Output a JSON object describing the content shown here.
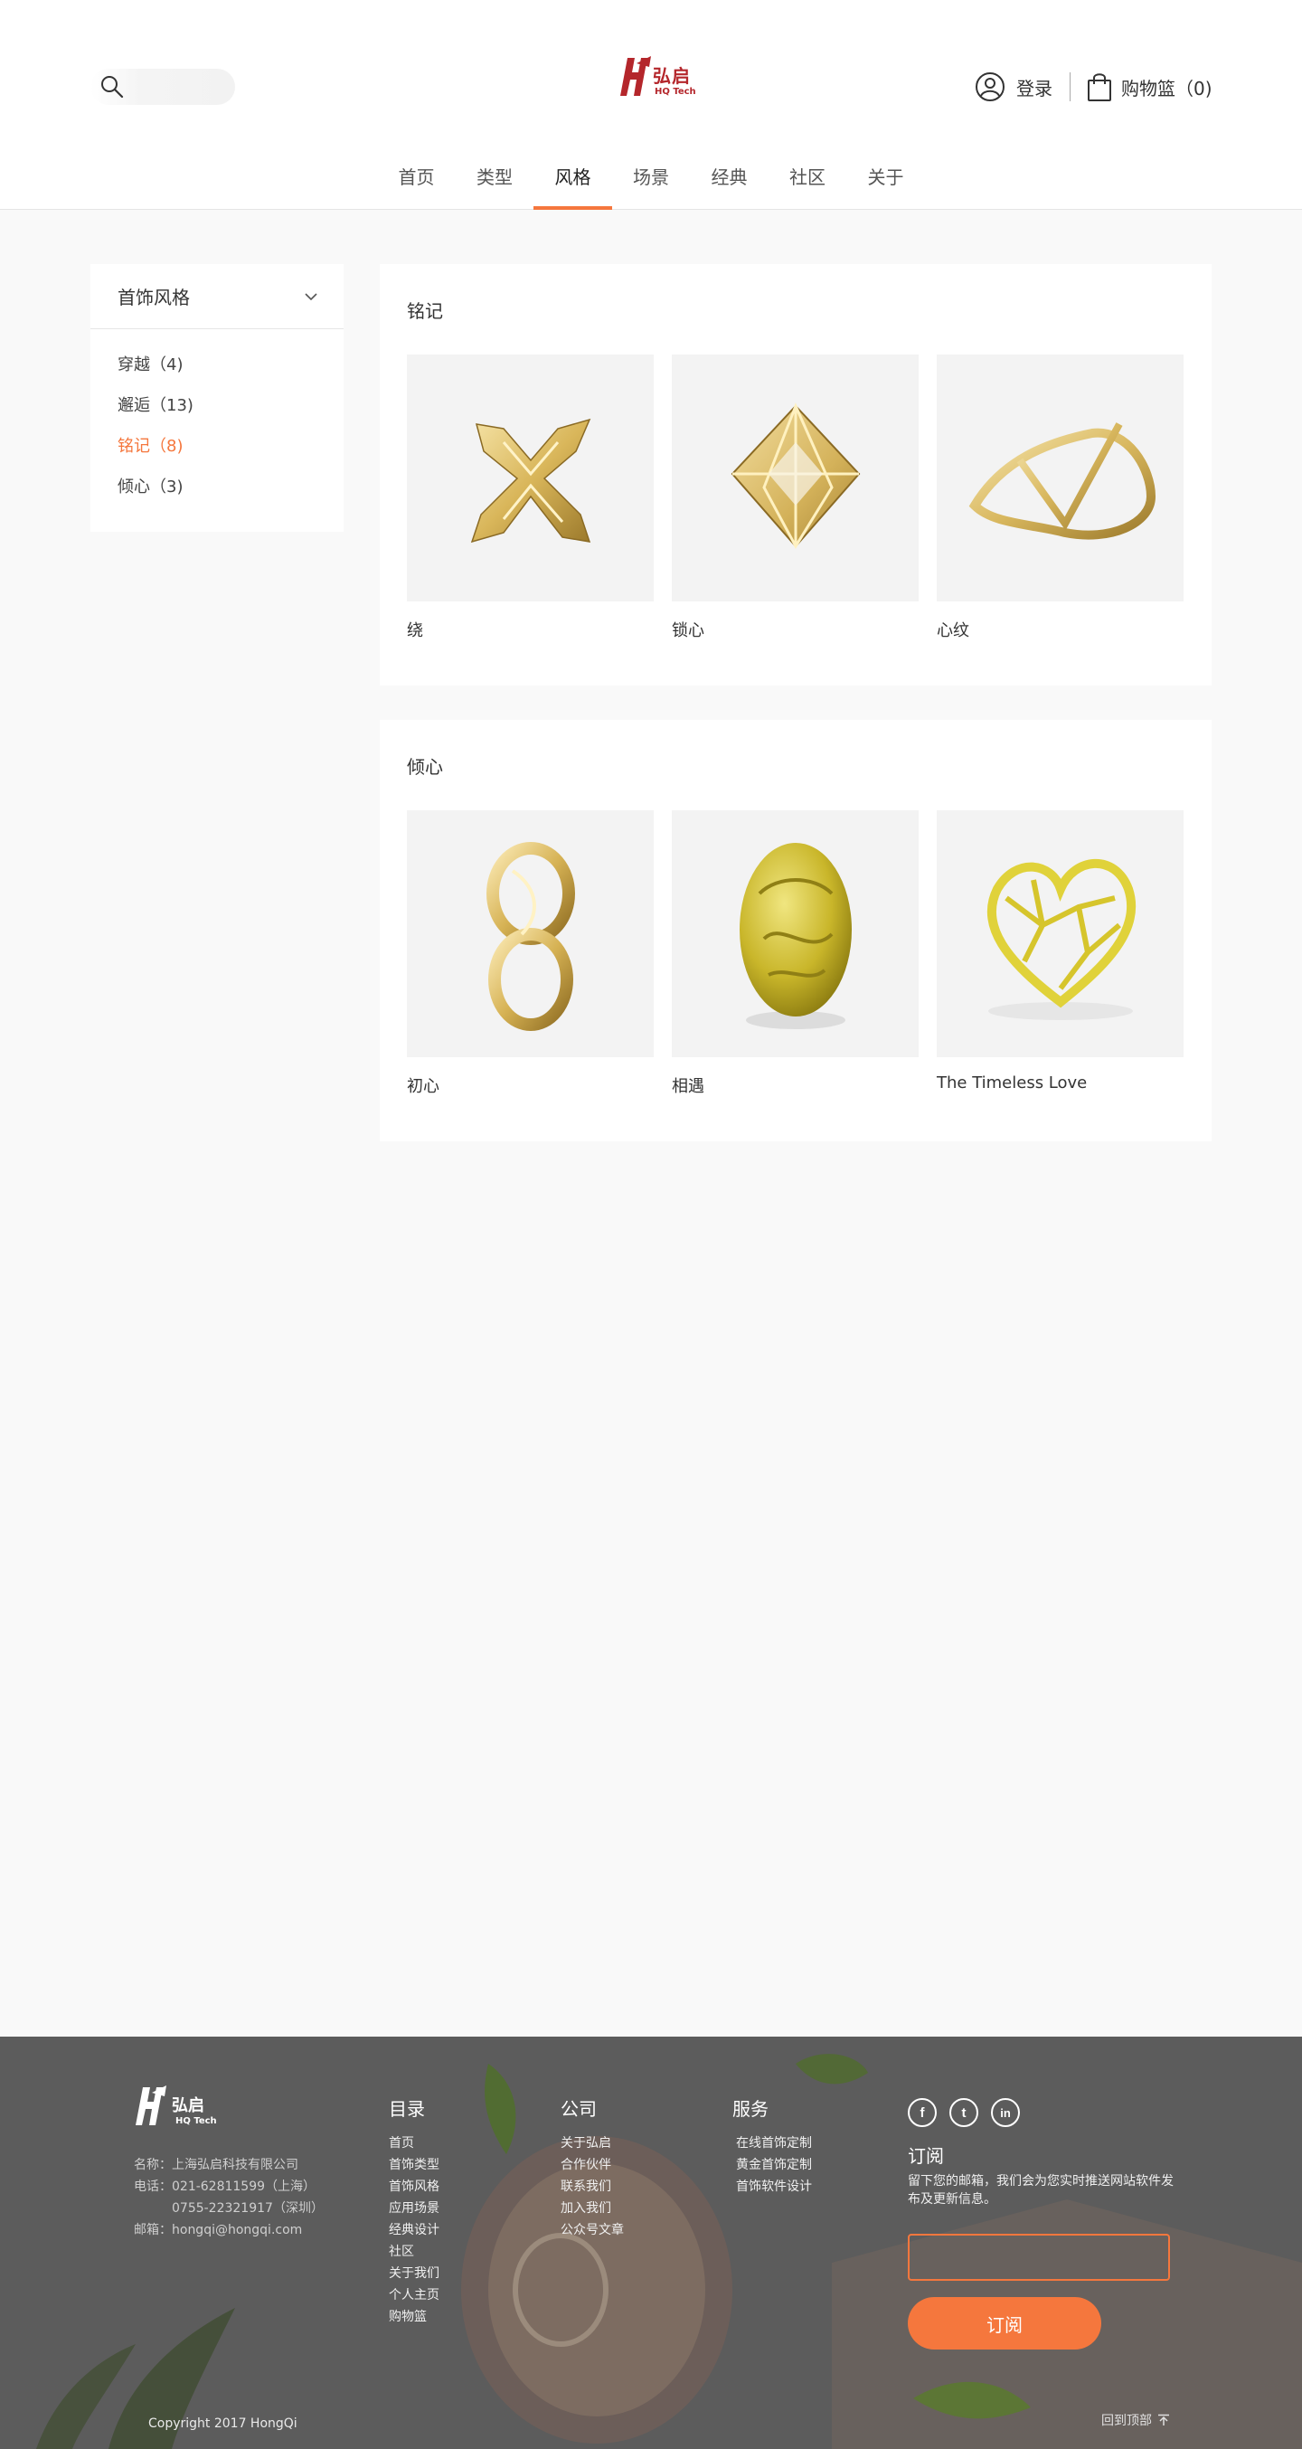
{
  "header": {
    "search_placeholder": "",
    "logo_brand": "弘启",
    "logo_sub": "HQ Tech",
    "login_label": "登录",
    "cart_label": "购物篮（0)"
  },
  "nav": {
    "tabs": [
      "首页",
      "类型",
      "风格",
      "场景",
      "经典",
      "社区",
      "关于"
    ],
    "active": "风格"
  },
  "sidebar": {
    "title": "首饰风格",
    "items": [
      {
        "label": "穿越（4)"
      },
      {
        "label": "邂逅（13)"
      },
      {
        "label": "铭记（8)"
      },
      {
        "label": "倾心（3)"
      }
    ],
    "active_index": 2
  },
  "sections": [
    {
      "title": "铭记",
      "products": [
        {
          "name": "绕",
          "icon": "gold-cross-pendant"
        },
        {
          "name": "锁心",
          "icon": "gold-octahedron-pendant"
        },
        {
          "name": "心纹",
          "icon": "gold-ribbon-ring"
        }
      ]
    },
    {
      "title": "倾心",
      "products": [
        {
          "name": "初心",
          "icon": "gold-figure-eight-pendant"
        },
        {
          "name": "相遇",
          "icon": "gold-carved-bead"
        },
        {
          "name": "The Timeless Love",
          "icon": "gold-lattice-heart"
        }
      ]
    }
  ],
  "footer": {
    "logo_brand": "弘启",
    "logo_sub": "HQ Tech",
    "info": {
      "name": "名称：上海弘启科技有限公司",
      "phone1": "电话：021-62811599（上海）",
      "phone2": "0755-22321917（深圳）",
      "email": "邮箱：hongqi@hongqi.com"
    },
    "directory": {
      "title": "目录",
      "links": [
        "首页",
        "首饰类型",
        "首饰风格",
        "应用场景",
        "经典设计",
        "社区",
        "关于我们",
        "个人主页",
        "购物篮"
      ]
    },
    "company": {
      "title": "公司",
      "links": [
        "关于弘启",
        "合作伙伴",
        "联系我们",
        "加入我们",
        "公众号文章"
      ]
    },
    "services": {
      "title": "服务",
      "links": [
        "在线首饰定制",
        "黄金首饰定制",
        "首饰软件设计"
      ]
    },
    "social": {
      "facebook": "f",
      "twitter": "t",
      "linkedin": "in"
    },
    "subscribe": {
      "title": "订阅",
      "desc": "留下您的邮箱，我们会为您实时推送网站软件发布及更新信息。",
      "input_value": "",
      "button": "订阅"
    },
    "copyright": "Copyright 2017 HongQi",
    "back_to_top": "回到顶部"
  },
  "colors": {
    "accent": "#f5773d",
    "brand_red": "#b4262b",
    "footer_bg": "#5c5c5c",
    "gold": "#e2c06a"
  }
}
